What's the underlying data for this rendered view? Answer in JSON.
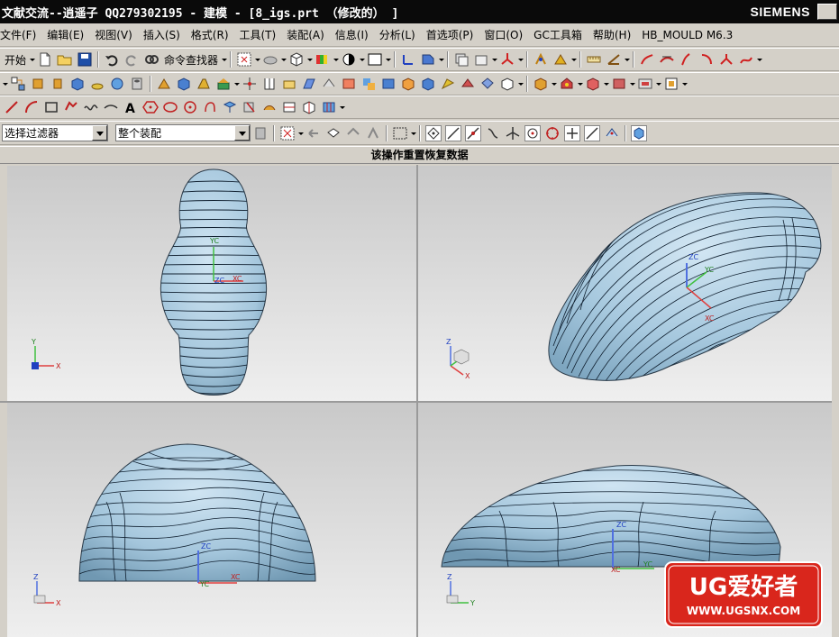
{
  "window": {
    "title": "文献交流--逍遥子 QQ279302195 - 建模 - [8_igs.prt （修改的） ]",
    "brand": "SIEMENS"
  },
  "menu": [
    "文件(F)",
    "编辑(E)",
    "视图(V)",
    "插入(S)",
    "格式(R)",
    "工具(T)",
    "装配(A)",
    "信息(I)",
    "分析(L)",
    "首选项(P)",
    "窗口(O)",
    "GC工具箱",
    "帮助(H)",
    "HB_MOULD M6.3"
  ],
  "toolbar1": {
    "start_label": "开始",
    "command_finder_label": "命令查找器"
  },
  "selection": {
    "filter_value": "选择过滤器",
    "scope_value": "整个装配"
  },
  "status_message": "该操作重置恢复数据",
  "axes": {
    "xc": "XC",
    "yc": "YC",
    "zc": "ZC",
    "x": "X",
    "y": "Y",
    "z": "Z"
  },
  "watermark": {
    "title": "UG爱好者",
    "url": "WWW.UGSNX.COM"
  },
  "colors": {
    "surface": "#a9cbe0",
    "viewport_bg_top": "#c9c9c9",
    "viewport_bg_bottom": "#efefef",
    "watermark_red": "#d9261c"
  }
}
